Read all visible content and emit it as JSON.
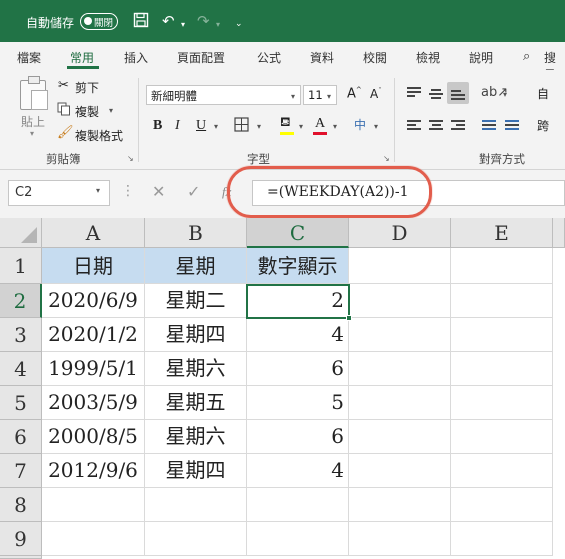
{
  "titlebar": {
    "autosave_label": "自動儲存",
    "autosave_state": "關閉"
  },
  "tabs": [
    {
      "label": "檔案"
    },
    {
      "label": "常用"
    },
    {
      "label": "插入"
    },
    {
      "label": "頁面配置"
    },
    {
      "label": "公式"
    },
    {
      "label": "資料"
    },
    {
      "label": "校閱"
    },
    {
      "label": "檢視"
    },
    {
      "label": "說明"
    },
    {
      "label": "搜尋"
    }
  ],
  "clipboard": {
    "paste_label": "貼上",
    "cut_label": "剪下",
    "copy_label": "複製",
    "format_painter_label": "複製格式",
    "group_label": "剪貼簿"
  },
  "font_group": {
    "font_name": "新細明體",
    "font_size": "11",
    "group_label": "字型"
  },
  "alignment_group": {
    "group_label": "對齊方式",
    "wrap_glyph": "自",
    "merge_glyph": "跨"
  },
  "formula_bar": {
    "name_box": "C2",
    "formula": "=(WEEKDAY(A2))-1"
  },
  "accent_colors": {
    "excel_green": "#217346",
    "header_fill": "#c6dcf0",
    "annotation_oval": "#e25d4c"
  },
  "sheet": {
    "columns": [
      "A",
      "B",
      "C",
      "D",
      "E"
    ],
    "rows": [
      "1",
      "2",
      "3",
      "4",
      "5",
      "6",
      "7",
      "8",
      "9"
    ],
    "headers": [
      "日期",
      "星期",
      "數字顯示"
    ],
    "data": [
      {
        "date": "2020/6/9",
        "weekday": "星期二",
        "number": "2"
      },
      {
        "date": "2020/1/2",
        "weekday": "星期四",
        "number": "4"
      },
      {
        "date": "1999/5/1",
        "weekday": "星期六",
        "number": "6"
      },
      {
        "date": "2003/5/9",
        "weekday": "星期五",
        "number": "5"
      },
      {
        "date": "2000/8/5",
        "weekday": "星期六",
        "number": "6"
      },
      {
        "date": "2012/9/6",
        "weekday": "星期四",
        "number": "4"
      }
    ]
  }
}
